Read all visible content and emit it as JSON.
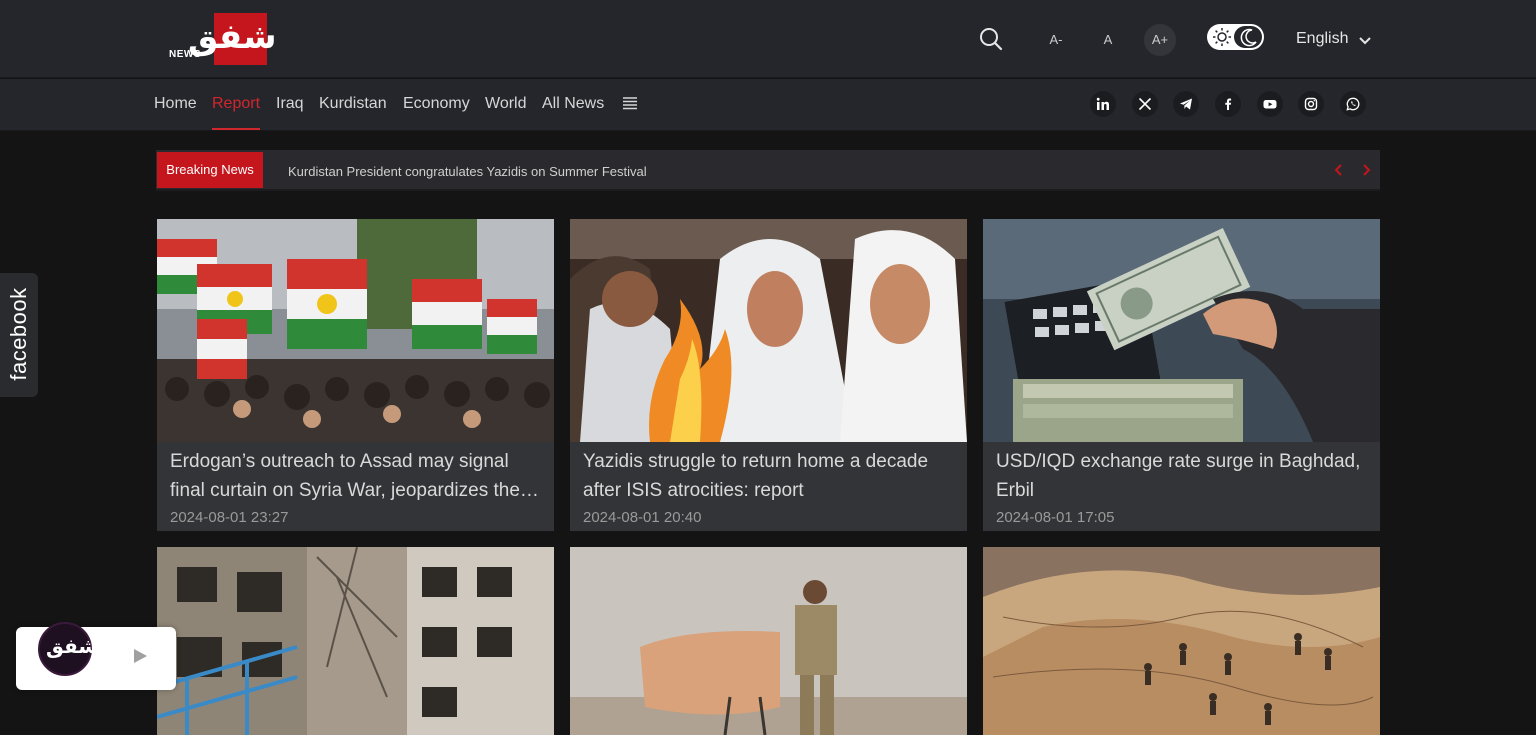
{
  "header": {
    "logo_ar": "شفق",
    "logo_news": "NEWS",
    "font_small": "A-",
    "font_normal": "A",
    "font_large": "A+",
    "language": "English"
  },
  "nav": {
    "items": [
      {
        "label": "Home"
      },
      {
        "label": "Report"
      },
      {
        "label": "Iraq"
      },
      {
        "label": "Kurdistan"
      },
      {
        "label": "Economy"
      },
      {
        "label": "World"
      },
      {
        "label": "All News"
      }
    ],
    "active": "Report"
  },
  "social_icons": [
    "linkedin-icon",
    "x-icon",
    "telegram-icon",
    "facebook-icon",
    "youtube-icon",
    "instagram-icon",
    "whatsapp-icon"
  ],
  "breaking": {
    "label": "Breaking News",
    "text": "Kurdistan President congratulates Yazidis on Summer Festival"
  },
  "articles": [
    {
      "title": "Erdogan’s outreach to Assad may signal final curtain on Syria War, jeopardizes the future of Syrian refugees",
      "date": "2024-08-01 23:27"
    },
    {
      "title": "Yazidis struggle to return home a decade after ISIS atrocities: report",
      "date": "2024-08-01 20:40"
    },
    {
      "title": "USD/IQD exchange rate surge in Baghdad, Erbil",
      "date": "2024-08-01 17:05"
    },
    {
      "title": "",
      "date": ""
    },
    {
      "title": "",
      "date": ""
    },
    {
      "title": "",
      "date": ""
    }
  ],
  "side_tab": {
    "label": "facebook"
  },
  "radio": {
    "logo_ar": "شفق"
  },
  "colors": {
    "accent": "#c4161c",
    "header_bg": "#25262b",
    "page_bg": "#141414",
    "card_bg": "#333438"
  }
}
